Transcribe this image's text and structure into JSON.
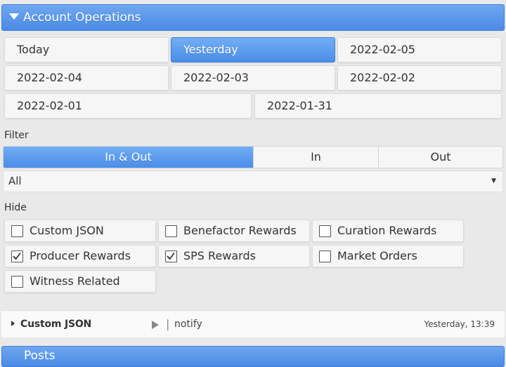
{
  "header": {
    "title": "Account Operations"
  },
  "date_buttons": [
    {
      "label": "Today",
      "active": false
    },
    {
      "label": "Yesterday",
      "active": true
    },
    {
      "label": "2022-02-05",
      "active": false
    },
    {
      "label": "2022-02-04",
      "active": false
    },
    {
      "label": "2022-02-03",
      "active": false
    },
    {
      "label": "2022-02-02",
      "active": false
    },
    {
      "label": "2022-02-01",
      "active": false
    },
    {
      "label": "2022-01-31",
      "active": false
    }
  ],
  "filter": {
    "label": "Filter",
    "segments": [
      {
        "label": "In & Out",
        "active": true
      },
      {
        "label": "In",
        "active": false
      },
      {
        "label": "Out",
        "active": false
      }
    ],
    "select_value": "All"
  },
  "hide": {
    "label": "Hide",
    "options": [
      {
        "label": "Custom JSON",
        "checked": false
      },
      {
        "label": "Benefactor Rewards",
        "checked": false
      },
      {
        "label": "Curation Rewards",
        "checked": false
      },
      {
        "label": "Producer Rewards",
        "checked": true
      },
      {
        "label": "SPS Rewards",
        "checked": true
      },
      {
        "label": "Market Orders",
        "checked": false
      },
      {
        "label": "Witness Related",
        "checked": false
      }
    ]
  },
  "operations": [
    {
      "type": "Custom JSON",
      "id": "notify",
      "time": "Yesterday, 13:39"
    }
  ],
  "next_section": {
    "title": "Posts"
  }
}
